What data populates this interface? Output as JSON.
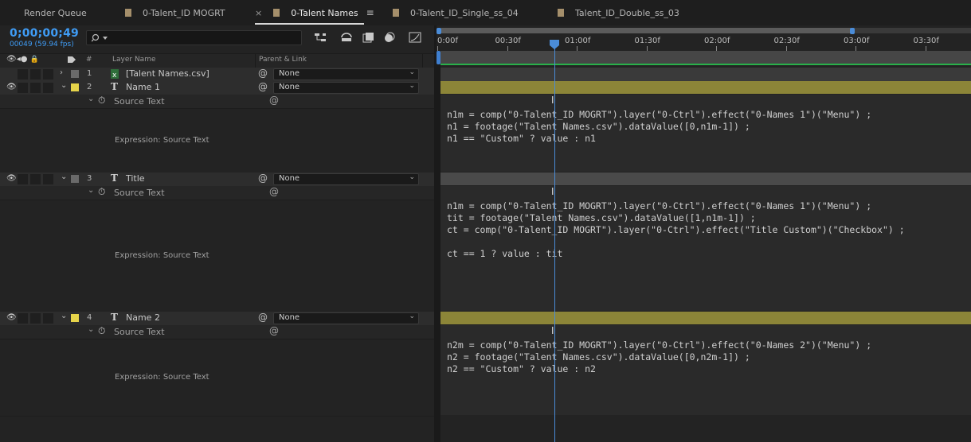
{
  "tabs": [
    {
      "label": "Render Queue"
    },
    {
      "label": "0-Talent_ID MOGRT",
      "swatch": "#a58f6b"
    },
    {
      "label": "0-Talent Names",
      "swatch": "#a58f6b",
      "active": true,
      "close": "×",
      "menu": "≡"
    },
    {
      "label": "0-Talent_ID_Single_ss_04",
      "swatch": "#a58f6b"
    },
    {
      "label": "Talent_ID_Double_ss_03",
      "swatch": "#a58f6b"
    }
  ],
  "timecode": "0;00;00;49",
  "frame_info": "00049 (59.94 fps)",
  "search": {
    "placeholder": "",
    "icon": "search-icon"
  },
  "columns": {
    "num": "#",
    "layer_name": "Layer Name",
    "parent": "Parent & Link"
  },
  "timeline_ticks": [
    "0:00f",
    "00:30f",
    "01:00f",
    "01:30f",
    "02:00f",
    "02:30f",
    "03:00f",
    "03:30f"
  ],
  "layers": [
    {
      "num": "1",
      "name": "[Talent Names.csv]",
      "label_color": "#6a6a6a",
      "parent": "None",
      "type_icon": "csv-footage-icon",
      "collapsed": true
    },
    {
      "num": "2",
      "name": "Name 1",
      "label_color": "#e6d44a",
      "parent": "None",
      "type_icon": "text-layer-icon",
      "property": "Source Text",
      "expression_label": "Expression: Source Text",
      "expression": "n1m = comp(\"0-Talent_ID MOGRT\").layer(\"0-Ctrl\").effect(\"0-Names 1\")(\"Menu\") ;\nn1 = footage(\"Talent Names.csv\").dataValue([0,n1m-1]) ;\nn1 == \"Custom\" ? value : n1",
      "track_color": "#8c8538"
    },
    {
      "num": "3",
      "name": "Title",
      "label_color": "#6a6a6a",
      "parent": "None",
      "type_icon": "text-layer-icon",
      "property": "Source Text",
      "expression_label": "Expression: Source Text",
      "expression": "n1m = comp(\"0-Talent_ID MOGRT\").layer(\"0-Ctrl\").effect(\"0-Names 1\")(\"Menu\") ;\ntit = footage(\"Talent Names.csv\").dataValue([1,n1m-1]) ;\nct = comp(\"0-Talent_ID MOGRT\").layer(\"0-Ctrl\").effect(\"Title Custom\")(\"Checkbox\") ;\n\nct == 1 ? value : tit",
      "track_color": "#4a4a4a"
    },
    {
      "num": "4",
      "name": "Name 2",
      "label_color": "#e6d44a",
      "parent": "None",
      "type_icon": "text-layer-icon",
      "property": "Source Text",
      "expression_label": "Expression: Source Text",
      "expression": "n2m = comp(\"0-Talent_ID MOGRT\").layer(\"0-Ctrl\").effect(\"0-Names 2\")(\"Menu\") ;\nn2 = footage(\"Talent Names.csv\").dataValue([0,n2m-1]) ;\nn2 == \"Custom\" ? value : n2",
      "track_color": "#8c8538"
    }
  ]
}
